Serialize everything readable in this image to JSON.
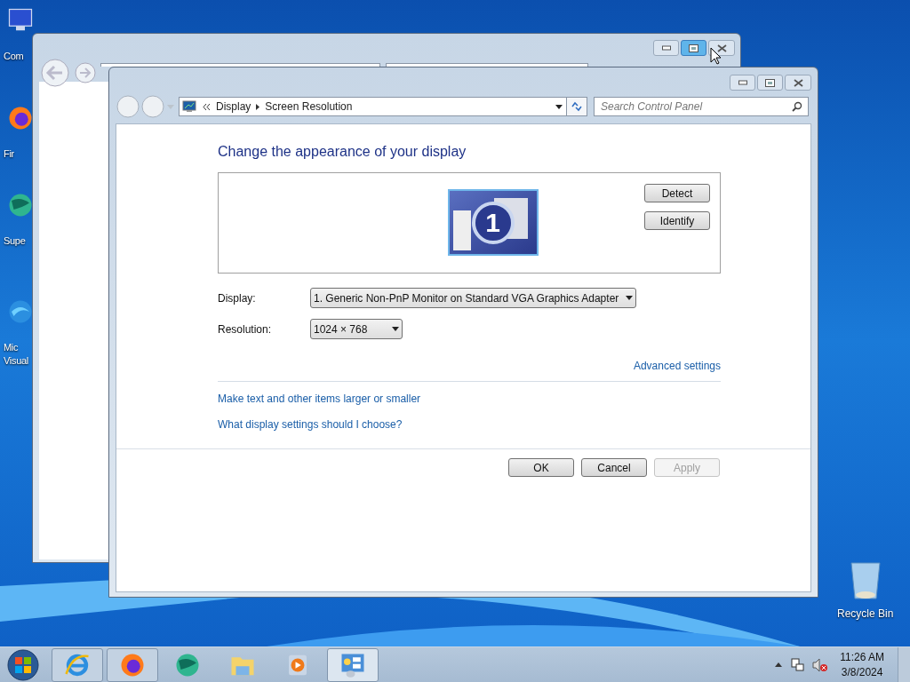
{
  "desktop_icons": [
    {
      "kind": "computer",
      "lines": [
        "Com"
      ]
    },
    {
      "kind": "firefox",
      "lines": [
        "Fir"
      ]
    },
    {
      "kind": "globe",
      "lines": [
        "Supe"
      ]
    },
    {
      "kind": "edge",
      "lines": [
        "Mic",
        "Visual"
      ]
    }
  ],
  "recycle_bin": {
    "label": "Recycle Bin"
  },
  "back_window": {
    "controls": [
      {
        "kind": "minimize",
        "hovered": false
      },
      {
        "kind": "maximize",
        "hovered": true
      },
      {
        "kind": "close",
        "hovered": false
      }
    ]
  },
  "window": {
    "controls": [
      {
        "kind": "minimize",
        "hovered": false
      },
      {
        "kind": "maximize",
        "hovered": false
      },
      {
        "kind": "close",
        "hovered": false
      }
    ],
    "breadcrumb": [
      "Display",
      "Screen Resolution"
    ],
    "search": {
      "placeholder": "Search Control Panel"
    },
    "heading": "Change the appearance of your display",
    "monitor_number": "1",
    "preview_buttons": [
      {
        "label": "Detect"
      },
      {
        "label": "Identify"
      }
    ],
    "fields": [
      {
        "label": "Display:",
        "value": "1. Generic Non-PnP Monitor on Standard VGA Graphics Adapter"
      },
      {
        "label": "Resolution:",
        "value": "1024 × 768"
      }
    ],
    "advanced_link": "Advanced settings",
    "links": [
      "Make text and other items larger or smaller",
      "What display settings should I choose?"
    ],
    "actions": [
      {
        "label": "OK",
        "disabled": false
      },
      {
        "label": "Cancel",
        "disabled": false
      },
      {
        "label": "Apply",
        "disabled": true
      }
    ]
  },
  "taskbar": {
    "apps": [
      {
        "kind": "ie",
        "running": true,
        "selected": false
      },
      {
        "kind": "firefox",
        "running": true,
        "selected": false
      },
      {
        "kind": "globe",
        "running": false,
        "selected": false
      },
      {
        "kind": "folder",
        "running": false,
        "selected": false
      },
      {
        "kind": "media",
        "running": false,
        "selected": false
      },
      {
        "kind": "control-panel",
        "running": true,
        "selected": true
      }
    ],
    "time": "11:26 AM",
    "date": "3/8/2024"
  }
}
